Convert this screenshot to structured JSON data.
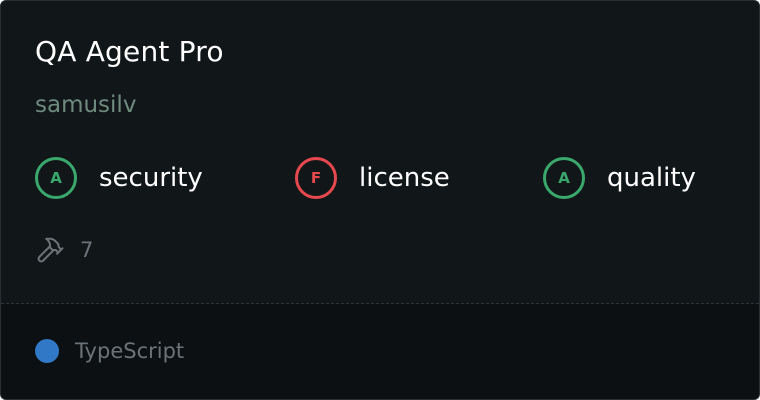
{
  "card": {
    "title": "QA Agent Pro",
    "owner": "samusilv"
  },
  "scores": [
    {
      "grade": "A",
      "label": "security",
      "status": "pass"
    },
    {
      "grade": "F",
      "label": "license",
      "status": "fail"
    },
    {
      "grade": "A",
      "label": "quality",
      "status": "pass"
    }
  ],
  "tools": {
    "icon": "hammer-icon",
    "count": "7"
  },
  "language": {
    "name": "TypeScript",
    "color": "#3178c6"
  },
  "colors": {
    "pass": "#3aa76d",
    "fail": "#e5484d"
  }
}
